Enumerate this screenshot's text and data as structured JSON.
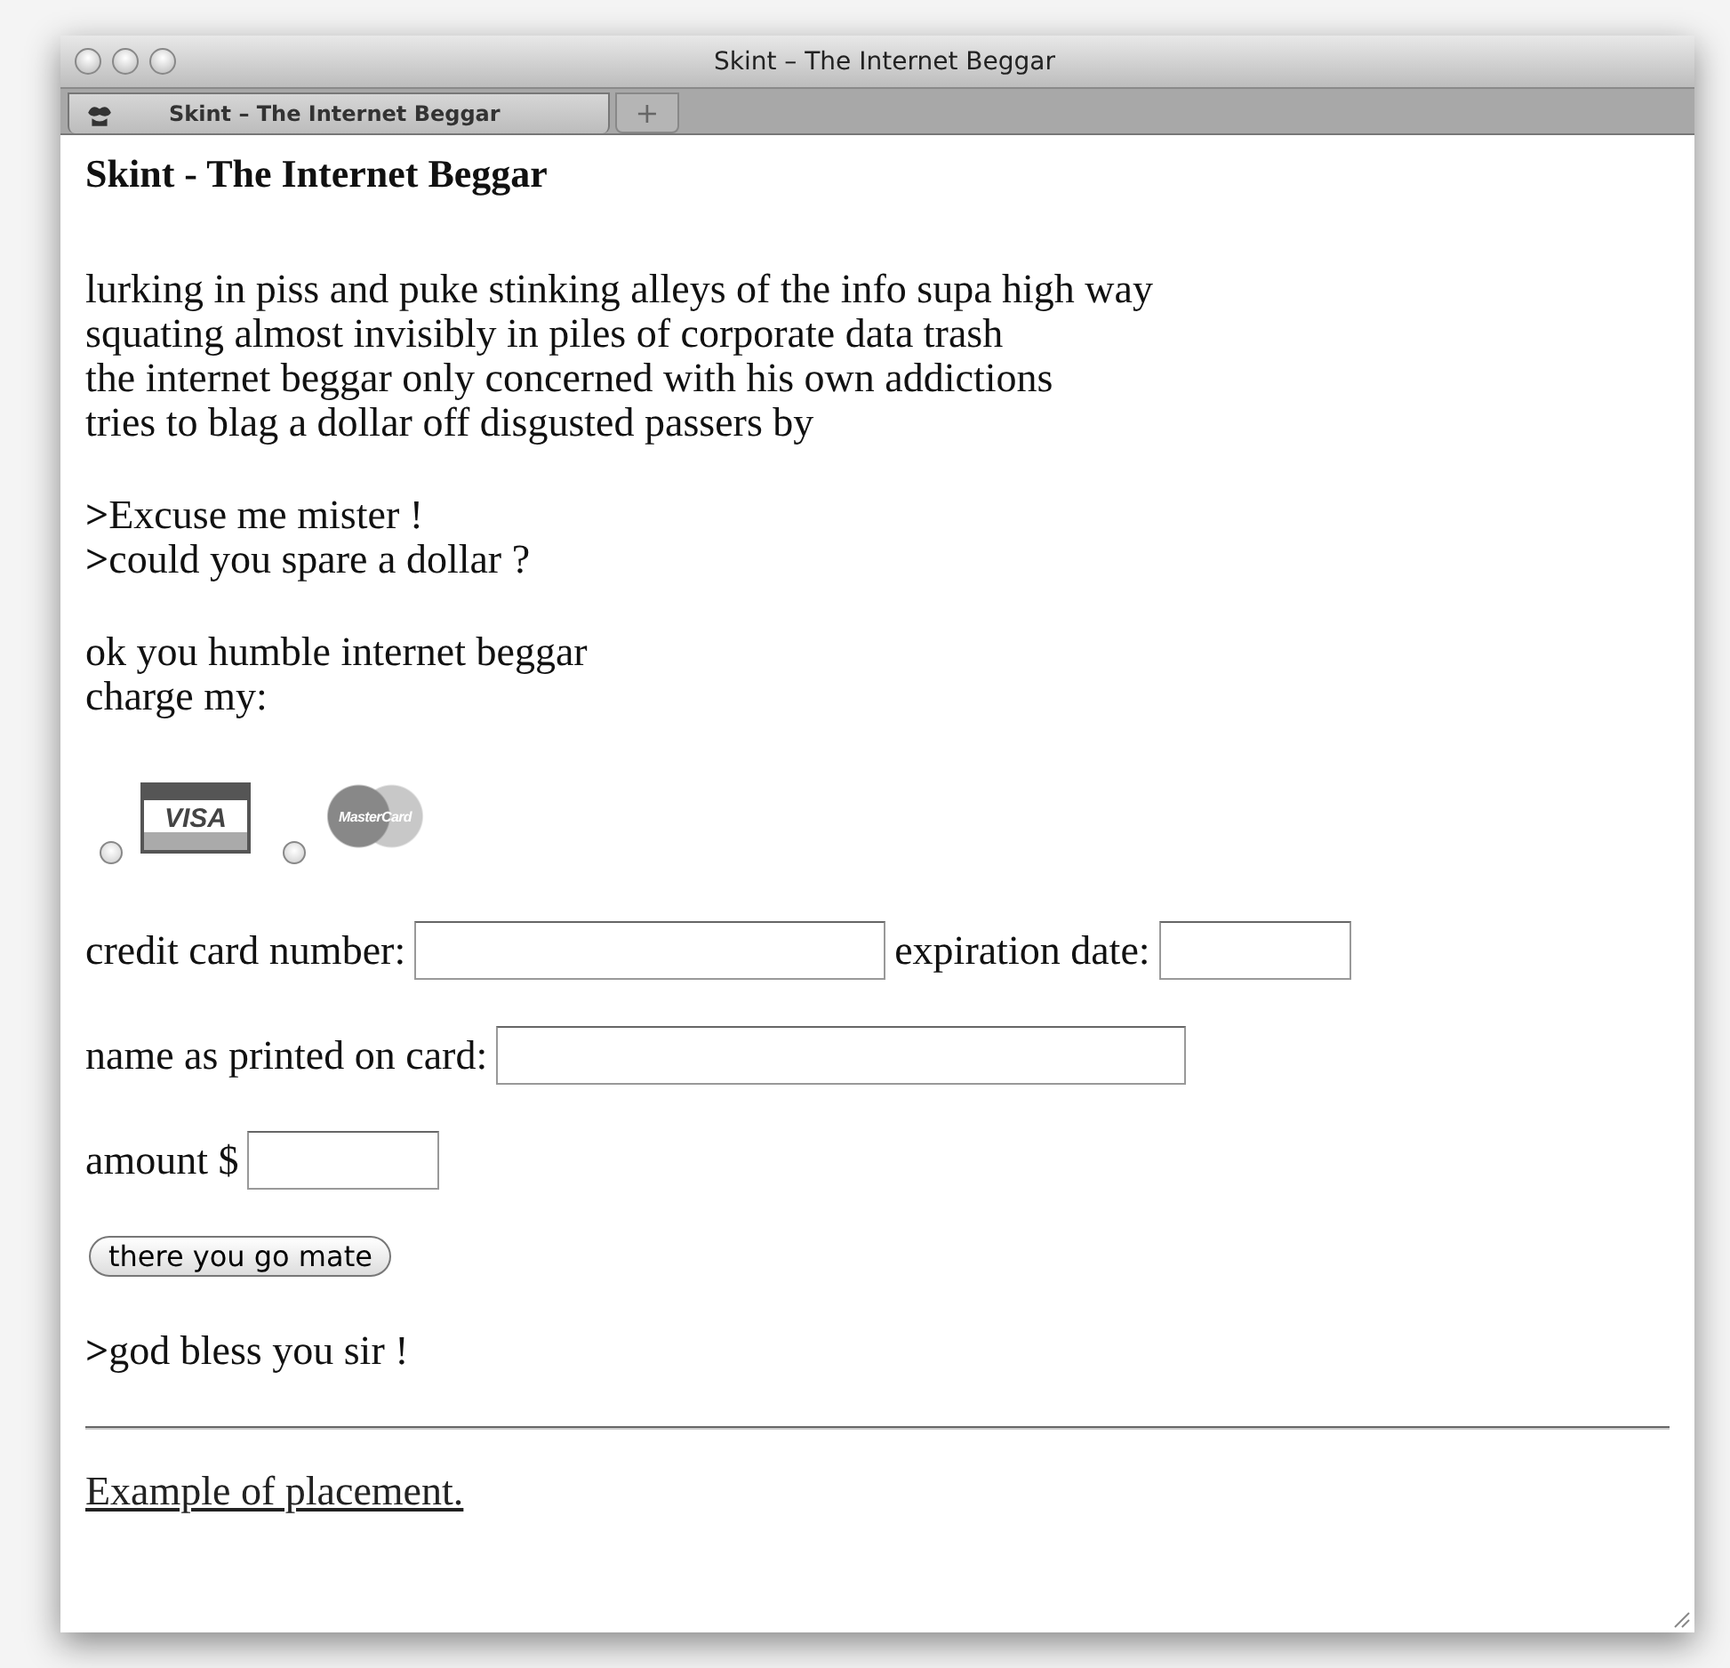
{
  "window": {
    "title": "Skint – The Internet Beggar"
  },
  "tabs": [
    {
      "label": "Skint – The Internet Beggar",
      "selected": true
    }
  ],
  "new_tab_button": "+",
  "page": {
    "heading": "Skint - The Internet Beggar",
    "poem": [
      "lurking in piss and puke stinking alleys of the info supa high way",
      "squating almost invisibly in piles of corporate data trash",
      "the internet beggar only concerned with his own addictions",
      "tries to blag a dollar off disgusted passers by"
    ],
    "plea": [
      "**>**Excuse me mister !",
      "**>**could you spare a dollar ?"
    ],
    "reply": [
      "ok you humble internet beggar",
      "charge my:"
    ],
    "card_options": [
      {
        "logo": "VISA",
        "kind": "visa",
        "selected": false
      },
      {
        "logo": "MasterCard",
        "kind": "mastercard",
        "selected": false
      }
    ],
    "form_rows": [
      {
        "fields": [
          {
            "label": "credit card number:",
            "kind": "card_number"
          },
          {
            "label": "expiration date:",
            "kind": "expiry"
          }
        ]
      },
      {
        "fields": [
          {
            "label": "name as printed on card:",
            "kind": "name"
          }
        ]
      },
      {
        "fields": [
          {
            "label": "amount $",
            "kind": "amount"
          }
        ]
      }
    ],
    "submit_button": "there you go mate",
    "blessing": "**>**god bless you sir !",
    "link": "Example of placement."
  }
}
